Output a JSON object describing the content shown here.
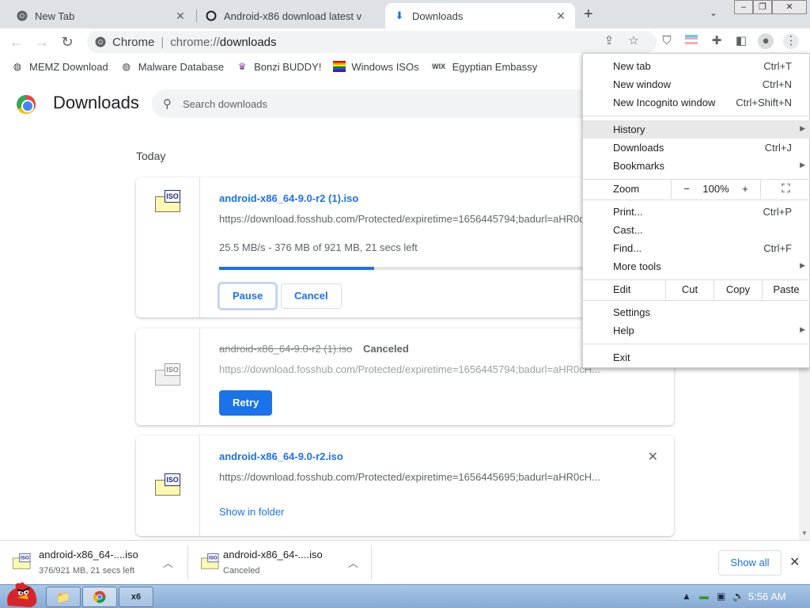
{
  "tabs": [
    {
      "title": "New Tab",
      "icon": "chrome-icon"
    },
    {
      "title": "Android-x86 download latest v",
      "icon": "loading-icon"
    },
    {
      "title": "Downloads",
      "icon": "download-icon"
    }
  ],
  "toolbar": {
    "omnibox_scheme": "Chrome",
    "omnibox_url_prefix": "chrome://",
    "omnibox_url_host": "downloads"
  },
  "bookmarks": [
    {
      "label": "MEMZ Download",
      "icon": "globe-icon"
    },
    {
      "label": "Malware Database",
      "icon": "globe-icon"
    },
    {
      "label": "Bonzi BUDDY!",
      "icon": "bonzi-icon"
    },
    {
      "label": "Windows ISOs",
      "icon": "rainbow-flag-icon"
    },
    {
      "label": "Egyptian Embassy",
      "icon": "wix-icon"
    }
  ],
  "page": {
    "title": "Downloads",
    "search_placeholder": "Search downloads",
    "section_today": "Today"
  },
  "downloads": [
    {
      "name": "android-x86_64-9.0-r2 (1).iso",
      "url": "https://download.fosshub.com/Protected/expiretime=1656445794;badurl=aHR0cH...",
      "progress_text": "25.5 MB/s - 376 MB of 921 MB, 21 secs left",
      "progress_fraction": 0.408,
      "pause_label": "Pause",
      "cancel_label": "Cancel"
    },
    {
      "name": "android-x86_64-9.0-r2 (1).iso",
      "status": "Canceled",
      "url": "https://download.fosshub.com/Protected/expiretime=1656445794;badurl=aHR0cH...",
      "retry_label": "Retry"
    },
    {
      "name": "android-x86_64-9.0-r2.iso",
      "url": "https://download.fosshub.com/Protected/expiretime=1656445695;badurl=aHR0cH...",
      "show_in_folder_label": "Show in folder"
    }
  ],
  "shelf": {
    "items": [
      {
        "name": "android-x86_64-....iso",
        "status": "376/921 MB, 21 secs left"
      },
      {
        "name": "android-x86_64-....iso",
        "status": "Canceled"
      }
    ],
    "show_all_label": "Show all"
  },
  "menu": {
    "new_tab": {
      "label": "New tab",
      "shortcut": "Ctrl+T"
    },
    "new_window": {
      "label": "New window",
      "shortcut": "Ctrl+N"
    },
    "new_incognito": {
      "label": "New Incognito window",
      "shortcut": "Ctrl+Shift+N"
    },
    "history": {
      "label": "History"
    },
    "downloads": {
      "label": "Downloads",
      "shortcut": "Ctrl+J"
    },
    "bookmarks": {
      "label": "Bookmarks"
    },
    "zoom": {
      "label": "Zoom",
      "minus": "−",
      "value": "100%",
      "plus": "+"
    },
    "print": {
      "label": "Print...",
      "shortcut": "Ctrl+P"
    },
    "cast": {
      "label": "Cast..."
    },
    "find": {
      "label": "Find...",
      "shortcut": "Ctrl+F"
    },
    "more_tools": {
      "label": "More tools"
    },
    "edit": {
      "label": "Edit",
      "cut": "Cut",
      "copy": "Copy",
      "paste": "Paste"
    },
    "settings": {
      "label": "Settings"
    },
    "help": {
      "label": "Help"
    },
    "exit": {
      "label": "Exit"
    }
  },
  "taskbar": {
    "clock": "5:56 AM"
  },
  "colors": {
    "accent": "#1a73e8",
    "tabstrip": "#dee1e6",
    "taskbar": "#a9c8e8"
  }
}
